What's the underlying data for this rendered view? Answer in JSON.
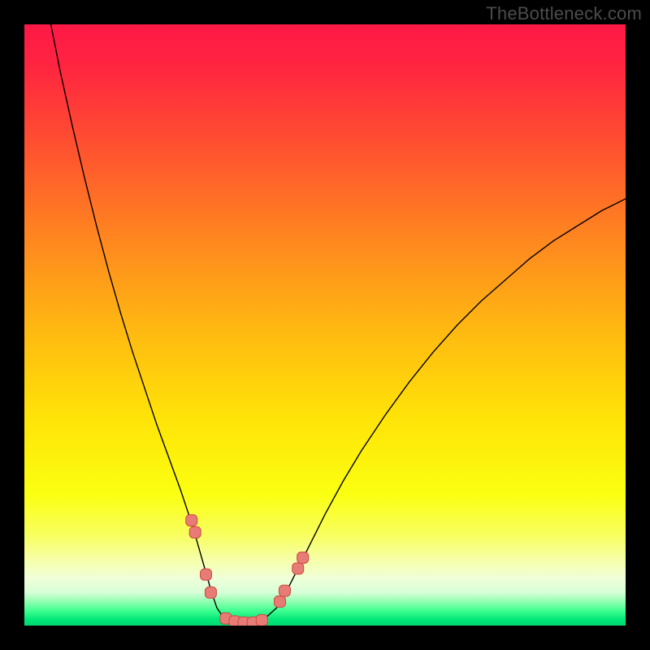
{
  "attribution": "TheBottleneck.com",
  "chart_data": {
    "type": "line",
    "title": "",
    "xlabel": "",
    "ylabel": "",
    "xlim": [
      0,
      100
    ],
    "ylim": [
      0,
      100
    ],
    "background_gradient": {
      "stops": [
        {
          "offset": 0.0,
          "color": "#ff1846"
        },
        {
          "offset": 0.07,
          "color": "#ff2540"
        },
        {
          "offset": 0.2,
          "color": "#ff5030"
        },
        {
          "offset": 0.35,
          "color": "#ff8420"
        },
        {
          "offset": 0.5,
          "color": "#ffb612"
        },
        {
          "offset": 0.65,
          "color": "#ffe208"
        },
        {
          "offset": 0.78,
          "color": "#fbff10"
        },
        {
          "offset": 0.85,
          "color": "#f8ff60"
        },
        {
          "offset": 0.89,
          "color": "#f6ffa8"
        },
        {
          "offset": 0.92,
          "color": "#f0ffd8"
        },
        {
          "offset": 0.945,
          "color": "#d8ffd8"
        },
        {
          "offset": 0.96,
          "color": "#90ffb0"
        },
        {
          "offset": 0.975,
          "color": "#40ff90"
        },
        {
          "offset": 0.99,
          "color": "#00e878"
        },
        {
          "offset": 1.0,
          "color": "#00d870"
        }
      ]
    },
    "series": [
      {
        "name": "curve",
        "color": "#000000",
        "width": 1.4,
        "x": [
          4.0,
          5.0,
          6.0,
          8.0,
          10.0,
          12.0,
          14.0,
          16.0,
          18.0,
          20.0,
          22.0,
          24.0,
          26.0,
          27.0,
          28.0,
          29.0,
          30.0,
          31.0,
          32.0,
          33.0,
          34.0,
          36.0,
          38.0,
          40.0,
          42.0,
          44.0,
          46.0,
          48.0,
          50.0,
          53.0,
          56.0,
          60.0,
          64.0,
          68.0,
          72.0,
          76.0,
          80.0,
          84.0,
          88.0,
          92.0,
          96.0,
          100.0
        ],
        "y": [
          102.0,
          97.0,
          92.0,
          83.0,
          74.5,
          66.5,
          59.0,
          52.0,
          45.5,
          39.5,
          33.5,
          28.0,
          22.5,
          19.5,
          16.5,
          13.0,
          9.5,
          6.0,
          3.0,
          1.5,
          0.8,
          0.5,
          0.5,
          1.2,
          3.0,
          6.5,
          10.5,
          14.5,
          18.5,
          24.0,
          29.0,
          35.0,
          40.5,
          45.5,
          50.0,
          54.0,
          57.5,
          61.0,
          64.0,
          66.5,
          69.0,
          71.0
        ]
      }
    ],
    "markers": {
      "shape": "rounded-square",
      "size": 14,
      "fill": "#e77c76",
      "stroke": "#d04840",
      "points": [
        {
          "x": 27.8,
          "y": 17.5
        },
        {
          "x": 28.4,
          "y": 15.5
        },
        {
          "x": 30.2,
          "y": 8.5
        },
        {
          "x": 31.0,
          "y": 5.5
        },
        {
          "x": 33.5,
          "y": 1.2
        },
        {
          "x": 35.0,
          "y": 0.7
        },
        {
          "x": 36.5,
          "y": 0.5
        },
        {
          "x": 38.0,
          "y": 0.5
        },
        {
          "x": 39.5,
          "y": 0.9
        },
        {
          "x": 42.5,
          "y": 4.0
        },
        {
          "x": 43.3,
          "y": 5.8
        },
        {
          "x": 45.5,
          "y": 9.5
        },
        {
          "x": 46.3,
          "y": 11.3
        }
      ]
    }
  }
}
